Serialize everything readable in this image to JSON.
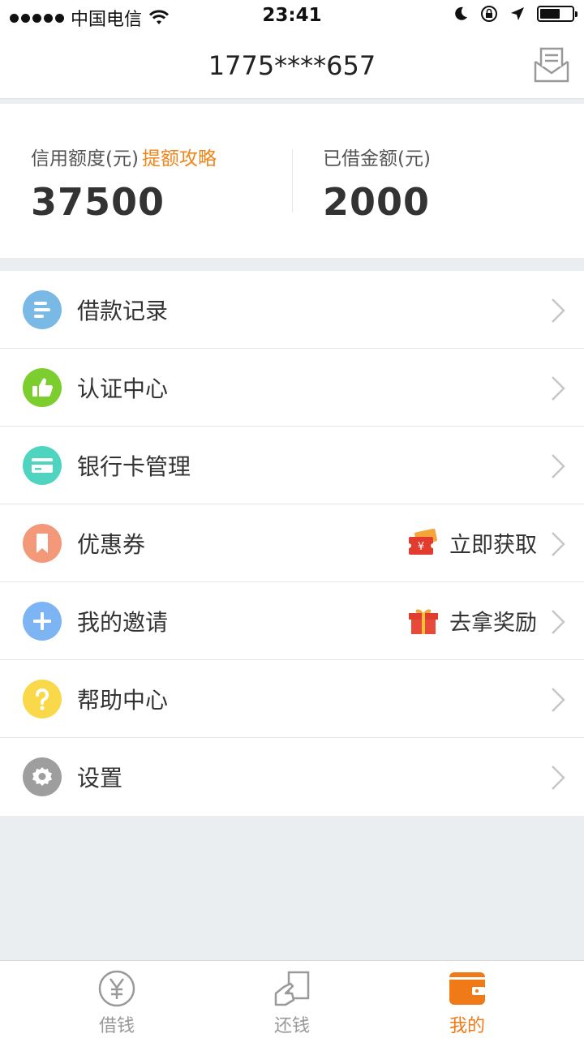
{
  "status_bar": {
    "carrier": "中国电信",
    "time": "23:41"
  },
  "header": {
    "title": "1775****657",
    "icons": {
      "message": "message-envelope-icon"
    }
  },
  "credit": {
    "limit_label": "信用额度(元)",
    "limit_link": "提额攻略",
    "limit_value": "37500",
    "borrowed_label": "已借金额(元)",
    "borrowed_value": "2000"
  },
  "menu": {
    "items": [
      {
        "label": "借款记录",
        "icon": "list-icon",
        "color": "#7ab8e6"
      },
      {
        "label": "认证中心",
        "icon": "thumbs-up-icon",
        "color": "#7ccd2e"
      },
      {
        "label": "银行卡管理",
        "icon": "bank-card-icon",
        "color": "#4fd4c0"
      },
      {
        "label": "优惠券",
        "icon": "bookmark-icon",
        "color": "#f39878",
        "extra": "立即获取",
        "extra_icon": "coupon-icon"
      },
      {
        "label": "我的邀请",
        "icon": "plus-icon",
        "color": "#7cb4f4",
        "extra": "去拿奖励",
        "extra_icon": "gift-icon"
      },
      {
        "label": "帮助中心",
        "icon": "question-icon",
        "color": "#f9d84a"
      },
      {
        "label": "设置",
        "icon": "gear-icon",
        "color": "#9e9e9e"
      }
    ]
  },
  "tab_bar": {
    "tabs": [
      {
        "label": "借钱",
        "icon": "yuan-coin-icon"
      },
      {
        "label": "还钱",
        "icon": "repay-hand-icon"
      },
      {
        "label": "我的",
        "icon": "wallet-icon",
        "active": true
      }
    ]
  },
  "colors": {
    "accent": "#f07a17",
    "link": "#f08519",
    "background": "#ebeef0"
  }
}
